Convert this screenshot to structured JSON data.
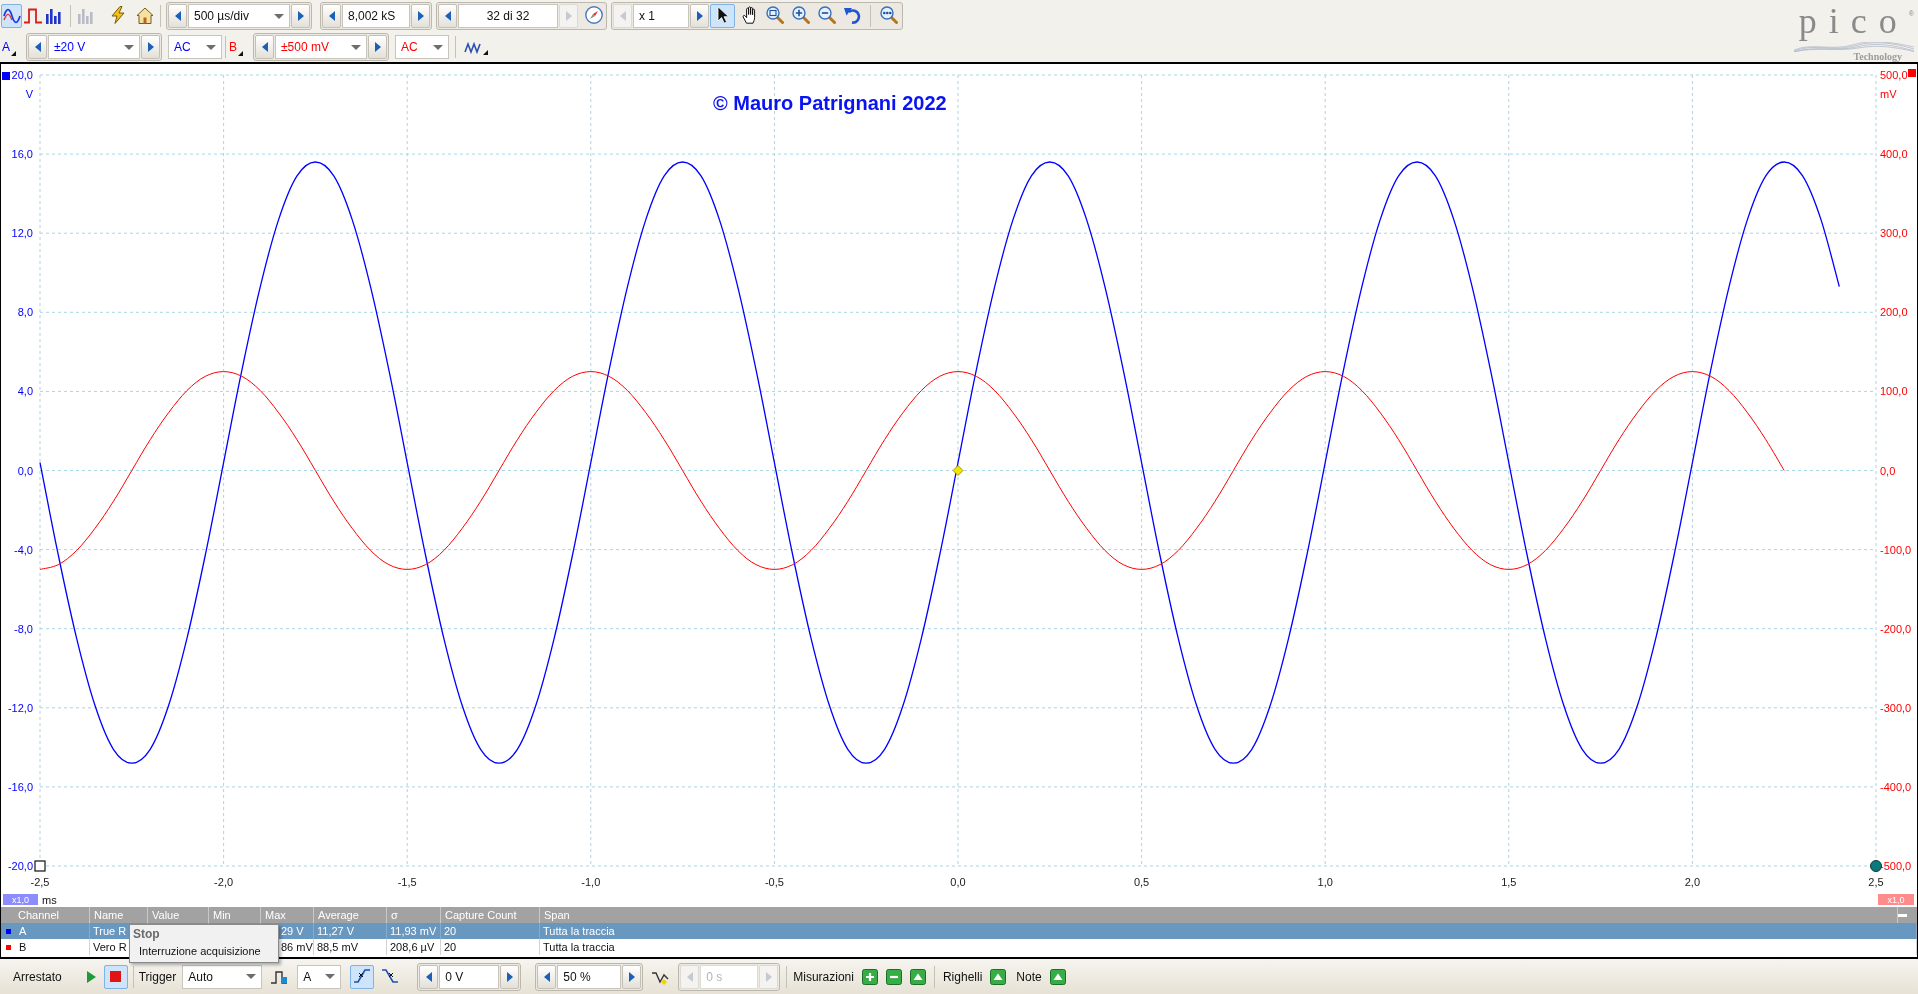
{
  "toolbar": {
    "view_modes": [
      {
        "kind": "scope",
        "selected": true
      },
      {
        "kind": "persistence",
        "selected": false
      },
      {
        "kind": "spectrum",
        "selected": false
      }
    ],
    "tools": [
      {
        "kind": "math",
        "disabled": true
      },
      {
        "kind": "generator",
        "disabled": false
      },
      {
        "kind": "home",
        "disabled": false
      }
    ],
    "timebase": "500 µs/div",
    "samples": "8,002 kS",
    "buffer": {
      "value": "32 di 32",
      "next_disabled": true
    },
    "zoom": {
      "value": "x 1",
      "prev_disabled": true
    },
    "pointer_tools": [
      {
        "kind": "pointer",
        "selected": true
      },
      {
        "kind": "hand",
        "selected": false
      },
      {
        "kind": "zoom_area",
        "selected": false
      },
      {
        "kind": "zoom_in",
        "selected": false
      },
      {
        "kind": "zoom_out",
        "selected": false
      },
      {
        "kind": "undo",
        "selected": false
      },
      {
        "kind": "zoom_fit",
        "selected": false
      }
    ]
  },
  "logo": {
    "name": "pico",
    "mark": "®",
    "tagline": "Technology"
  },
  "channels": [
    {
      "label": "A",
      "color": "#0000ff",
      "range": "±20 V",
      "coupling": "AC",
      "axis_scale": "x1,0"
    },
    {
      "label": "B",
      "color": "#ff0000",
      "range": "±500 mV",
      "coupling": "AC",
      "axis_scale": "x1,0"
    }
  ],
  "scope": {
    "note": "© Mauro Patrignani 2022",
    "chart_data": {
      "type": "line",
      "grid": true,
      "xlabel": "ms",
      "ylabel": "V",
      "y2label": "mV",
      "x": [
        -2.5,
        -2.45,
        -2.4,
        -2.35,
        -2.3,
        -2.25,
        -2.2,
        -2.15,
        -2.1,
        -2.05,
        -2,
        -1.95,
        -1.9,
        -1.85,
        -1.8,
        -1.75,
        -1.7,
        -1.65,
        -1.6,
        -1.55,
        -1.5,
        -1.45,
        -1.4,
        -1.35,
        -1.3,
        -1.25,
        -1.2,
        -1.15,
        -1.1,
        -1.05,
        -1,
        -0.95,
        -0.9,
        -0.85,
        -0.8,
        -0.75,
        -0.7,
        -0.65,
        -0.6,
        -0.55,
        -0.5,
        -0.45,
        -0.4,
        -0.35,
        -0.3,
        -0.25,
        -0.2,
        -0.15,
        -0.1,
        -0.05,
        0,
        0.05,
        0.1,
        0.15,
        0.2,
        0.25,
        0.3,
        0.35,
        0.4,
        0.45,
        0.5,
        0.55,
        0.6,
        0.65,
        0.7,
        0.75,
        0.8,
        0.85,
        0.9,
        0.95,
        1,
        1.05,
        1.1,
        1.15,
        1.2,
        1.25,
        1.3,
        1.35,
        1.4,
        1.45,
        1.5,
        1.55,
        1.6,
        1.65,
        1.7,
        1.75,
        1.8,
        1.85,
        1.9,
        1.95,
        2,
        2.05,
        2.1,
        2.15,
        2.2,
        2.25,
        2.3,
        2.35,
        2.4
      ],
      "series": [
        {
          "color": "#0000ff",
          "values": [
            0.4,
            -4.3,
            -8.5,
            -11.9,
            -14.1,
            -14.8,
            -14.1,
            -11.9,
            -8.5,
            -4.3,
            0.4,
            5.1,
            9.3,
            12.7,
            14.9,
            15.6,
            14.9,
            12.7,
            9.3,
            5.1,
            0.4,
            -4.3,
            -8.5,
            -11.9,
            -14.1,
            -14.8,
            -14.1,
            -11.9,
            -8.5,
            -4.3,
            0.4,
            5.1,
            9.3,
            12.7,
            14.9,
            15.6,
            14.9,
            12.7,
            9.3,
            5.1,
            0.4,
            -4.3,
            -8.5,
            -11.9,
            -14.1,
            -14.8,
            -14.1,
            -11.9,
            -8.5,
            -4.3,
            0.4,
            5.1,
            9.3,
            12.7,
            14.9,
            15.6,
            14.9,
            12.7,
            9.3,
            5.1,
            0.4,
            -4.3,
            -8.5,
            -11.9,
            -14.1,
            -14.8,
            -14.1,
            -11.9,
            -8.5,
            -4.3,
            0.4,
            5.1,
            9.3,
            12.7,
            14.9,
            15.6,
            14.9,
            12.7,
            9.3,
            5.1,
            0.4,
            -4.3,
            -8.5,
            -11.9,
            -14.1,
            -14.8,
            -14.1,
            -11.9,
            -8.5,
            -4.3,
            0.4,
            5.1,
            9.3,
            12.7,
            14.9,
            15.6,
            14.9,
            12.7,
            9.3
          ]
        },
        {
          "color": "#ff0000",
          "axis": "y2",
          "values": [
            -125,
            -119,
            -101,
            -73,
            -39,
            0,
            39,
            73,
            101,
            119,
            125,
            119,
            101,
            73,
            39,
            0,
            -39,
            -73,
            -101,
            -119,
            -125,
            -119,
            -101,
            -73,
            -39,
            0,
            39,
            73,
            101,
            119,
            125,
            119,
            101,
            73,
            39,
            0,
            -39,
            -73,
            -101,
            -119,
            -125,
            -119,
            -101,
            -73,
            -39,
            0,
            39,
            73,
            101,
            119,
            125,
            119,
            101,
            73,
            39,
            0,
            -39,
            -73,
            -101,
            -119,
            -125,
            -119,
            -101,
            -73,
            -39,
            0,
            39,
            73,
            101,
            119,
            125,
            119,
            101,
            73,
            39,
            0,
            -39,
            -73,
            -101,
            -119,
            -125,
            -119,
            -101,
            -73,
            -39,
            0,
            39,
            73,
            101,
            119,
            125,
            119,
            101,
            73,
            39,
            0,
            null,
            null,
            null
          ]
        }
      ],
      "xlim": [
        -2.5,
        2.5
      ],
      "ylim": [
        -20,
        20
      ],
      "y2lim": [
        -500,
        500
      ],
      "xticks": [
        {
          "value": -2.5,
          "label": "-2,5"
        },
        {
          "value": -2,
          "label": "-2,0"
        },
        {
          "value": -1.5,
          "label": "-1,5"
        },
        {
          "value": -1,
          "label": "-1,0"
        },
        {
          "value": -0.5,
          "label": "-0,5"
        },
        {
          "value": 0,
          "label": "0,0"
        },
        {
          "value": 0.5,
          "label": "0,5"
        },
        {
          "value": 1,
          "label": "1,0"
        },
        {
          "value": 1.5,
          "label": "1,5"
        },
        {
          "value": 2,
          "label": "2,0"
        },
        {
          "value": 2.5,
          "label": "2,5"
        }
      ],
      "yticks": [
        {
          "value": 20,
          "label": "20,0"
        },
        {
          "value": 16,
          "label": "16,0"
        },
        {
          "value": 12,
          "label": "12,0"
        },
        {
          "value": 8,
          "label": "8,0"
        },
        {
          "value": 4,
          "label": "4,0"
        },
        {
          "value": 0,
          "label": "0,0"
        },
        {
          "value": -4,
          "label": "-4,0"
        },
        {
          "value": -8,
          "label": "-8,0"
        },
        {
          "value": -12,
          "label": "-12,0"
        },
        {
          "value": -16,
          "label": "-16,0"
        },
        {
          "value": -20,
          "label": "-20,0"
        }
      ],
      "y2ticks": [
        {
          "value": 500,
          "label": "500,0"
        },
        {
          "value": 400,
          "label": "400,0"
        },
        {
          "value": 300,
          "label": "300,0"
        },
        {
          "value": 200,
          "label": "200,0"
        },
        {
          "value": 100,
          "label": "100,0"
        },
        {
          "value": 0,
          "label": "0,0"
        },
        {
          "value": -100,
          "label": "-100,0"
        },
        {
          "value": -200,
          "label": "-200,0"
        },
        {
          "value": -300,
          "label": "-300,0"
        },
        {
          "value": -400,
          "label": "-400,0"
        },
        {
          "value": -500,
          "label": "-500,0"
        }
      ]
    }
  },
  "measurements": {
    "columns": [
      "Channel",
      "Name",
      "Value",
      "Min",
      "Max",
      "Average",
      "σ",
      "Capture Count",
      "Span"
    ],
    "rows": [
      {
        "channel": "A",
        "color": "#0000ff",
        "selected": true,
        "name": "True R",
        "max": "29 V",
        "average": "11,27 V",
        "sigma": "11,93 mV",
        "capture_count": "20",
        "span": "Tutta la traccia"
      },
      {
        "channel": "B",
        "color": "#ff0000",
        "selected": false,
        "name": "Vero R",
        "max": "86 mV",
        "average": "88,5 mV",
        "sigma": "208,6 µV",
        "capture_count": "20",
        "span": "Tutta la traccia"
      }
    ]
  },
  "tooltip": {
    "title": "Stop",
    "text": "Interruzione acquisizione"
  },
  "status_bar": {
    "state": "Arrestato",
    "running": false,
    "trigger_label": "Trigger",
    "trigger_mode": "Auto",
    "trigger_source": "A",
    "edges": [
      {
        "kind": "rising",
        "selected": true
      },
      {
        "kind": "falling",
        "selected": false
      }
    ],
    "threshold": "0 V",
    "pre_trigger": "50 %",
    "delay": {
      "value": "0 s",
      "disabled": true
    },
    "sections": [
      {
        "label": "Misurazioni",
        "actions": [
          {
            "kind": "add"
          },
          {
            "kind": "remove"
          },
          {
            "kind": "expand"
          }
        ]
      },
      {
        "label": "Righelli",
        "actions": [
          {
            "kind": "expand"
          }
        ]
      },
      {
        "label": "Note",
        "actions": [
          {
            "kind": "expand"
          }
        ]
      }
    ]
  }
}
